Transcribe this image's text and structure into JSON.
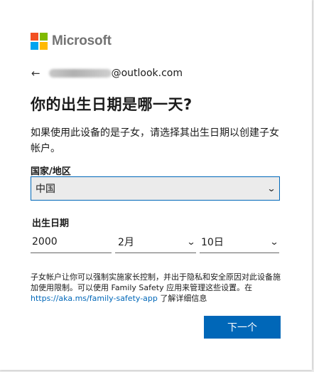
{
  "brand": {
    "name": "Microsoft",
    "colors": {
      "red": "#f25022",
      "green": "#7fba00",
      "blue": "#00a4ef",
      "yellow": "#ffb900"
    }
  },
  "account": {
    "email_suffix": "@outlook.com"
  },
  "title": "你的出生日期是哪一天?",
  "description": "如果使用此设备的是子女，请选择其出生日期以创建子女帐户。",
  "country": {
    "label": "国家/地区",
    "selected": "中国"
  },
  "birthdate": {
    "label": "出生日期",
    "year": "2000",
    "month": "2月",
    "day": "10日"
  },
  "note": {
    "text1": "子女帐户让你可以强制实施家长控制，并出于隐私和安全原因对此设备施加使用限制。可以使用 Family Safety 应用来管理这些设置。在 ",
    "link": "https://aka.ms/family-safety-app",
    "text2": " 了解详细信息"
  },
  "actions": {
    "next_label": "下一个"
  },
  "accent_color": "#0067b8"
}
